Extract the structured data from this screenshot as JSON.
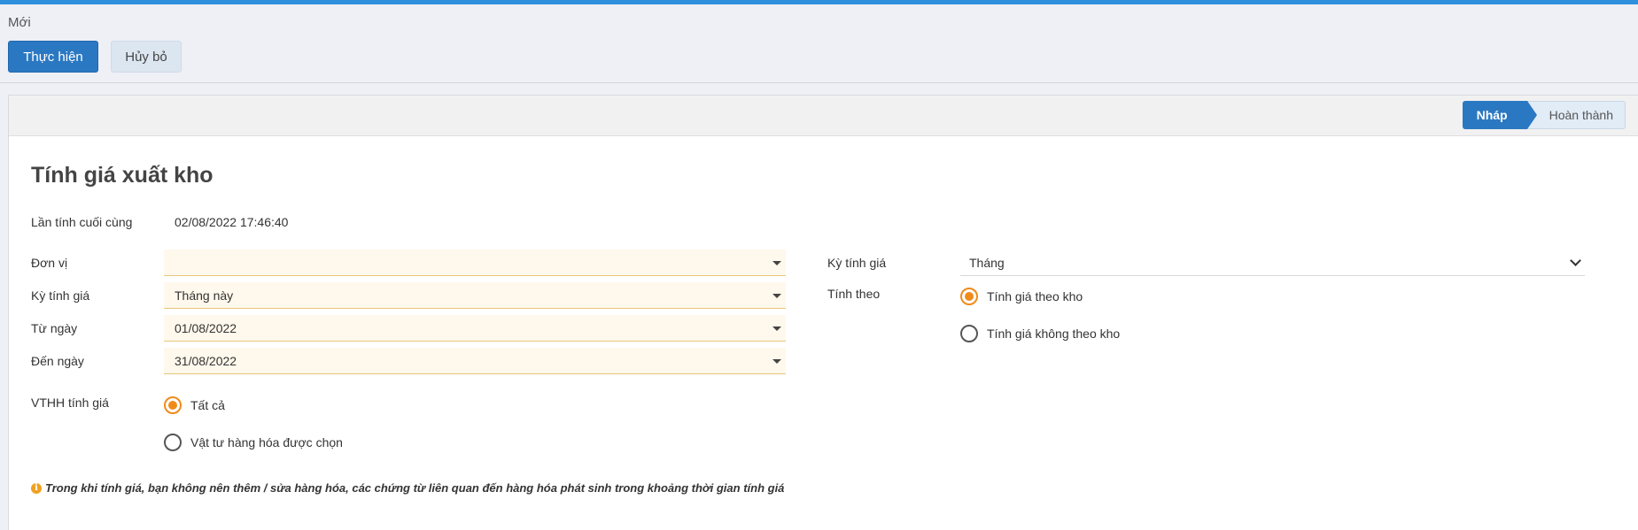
{
  "header": {
    "breadcrumb": "Mới",
    "execute_label": "Thực hiện",
    "cancel_label": "Hủy bỏ"
  },
  "status": {
    "steps": [
      "Nháp",
      "Hoàn thành"
    ],
    "active_step": "Nháp"
  },
  "form": {
    "title": "Tính giá xuất kho",
    "last_calc_label": "Lần tính cuối cùng",
    "last_calc_value": "02/08/2022 17:46:40",
    "unit_label": "Đơn vị",
    "unit_value": "",
    "period_label": "Kỳ tính giá",
    "period_value": "Tháng này",
    "from_label": "Từ ngày",
    "from_value": "01/08/2022",
    "to_label": "Đến ngày",
    "to_value": "31/08/2022",
    "items_label": "VTHH tính giá",
    "items_options": [
      "Tất cả",
      "Vật tư hàng hóa được chọn"
    ],
    "items_selected": "Tất cả",
    "right_period_label": "Kỳ tính giá",
    "right_period_value": "Tháng",
    "calc_by_label": "Tính theo",
    "calc_by_options": [
      "Tính giá theo kho",
      "Tính giá không theo kho"
    ],
    "calc_by_selected": "Tính giá theo kho",
    "note": "Trong khi tính giá, bạn không nên thêm / sửa hàng hóa, các chứng từ liên quan đến hàng hóa phát sinh trong khoảng thời gian tính giá"
  },
  "colors": {
    "primary": "#2b78c2",
    "radio_accent": "#f08b1a",
    "required_field_bg": "#fff8ec",
    "info_icon": "#f0a020"
  },
  "icons": {
    "info": "info-circle-icon",
    "dropdown": "caret-down-icon",
    "select": "chevron-down-icon"
  }
}
